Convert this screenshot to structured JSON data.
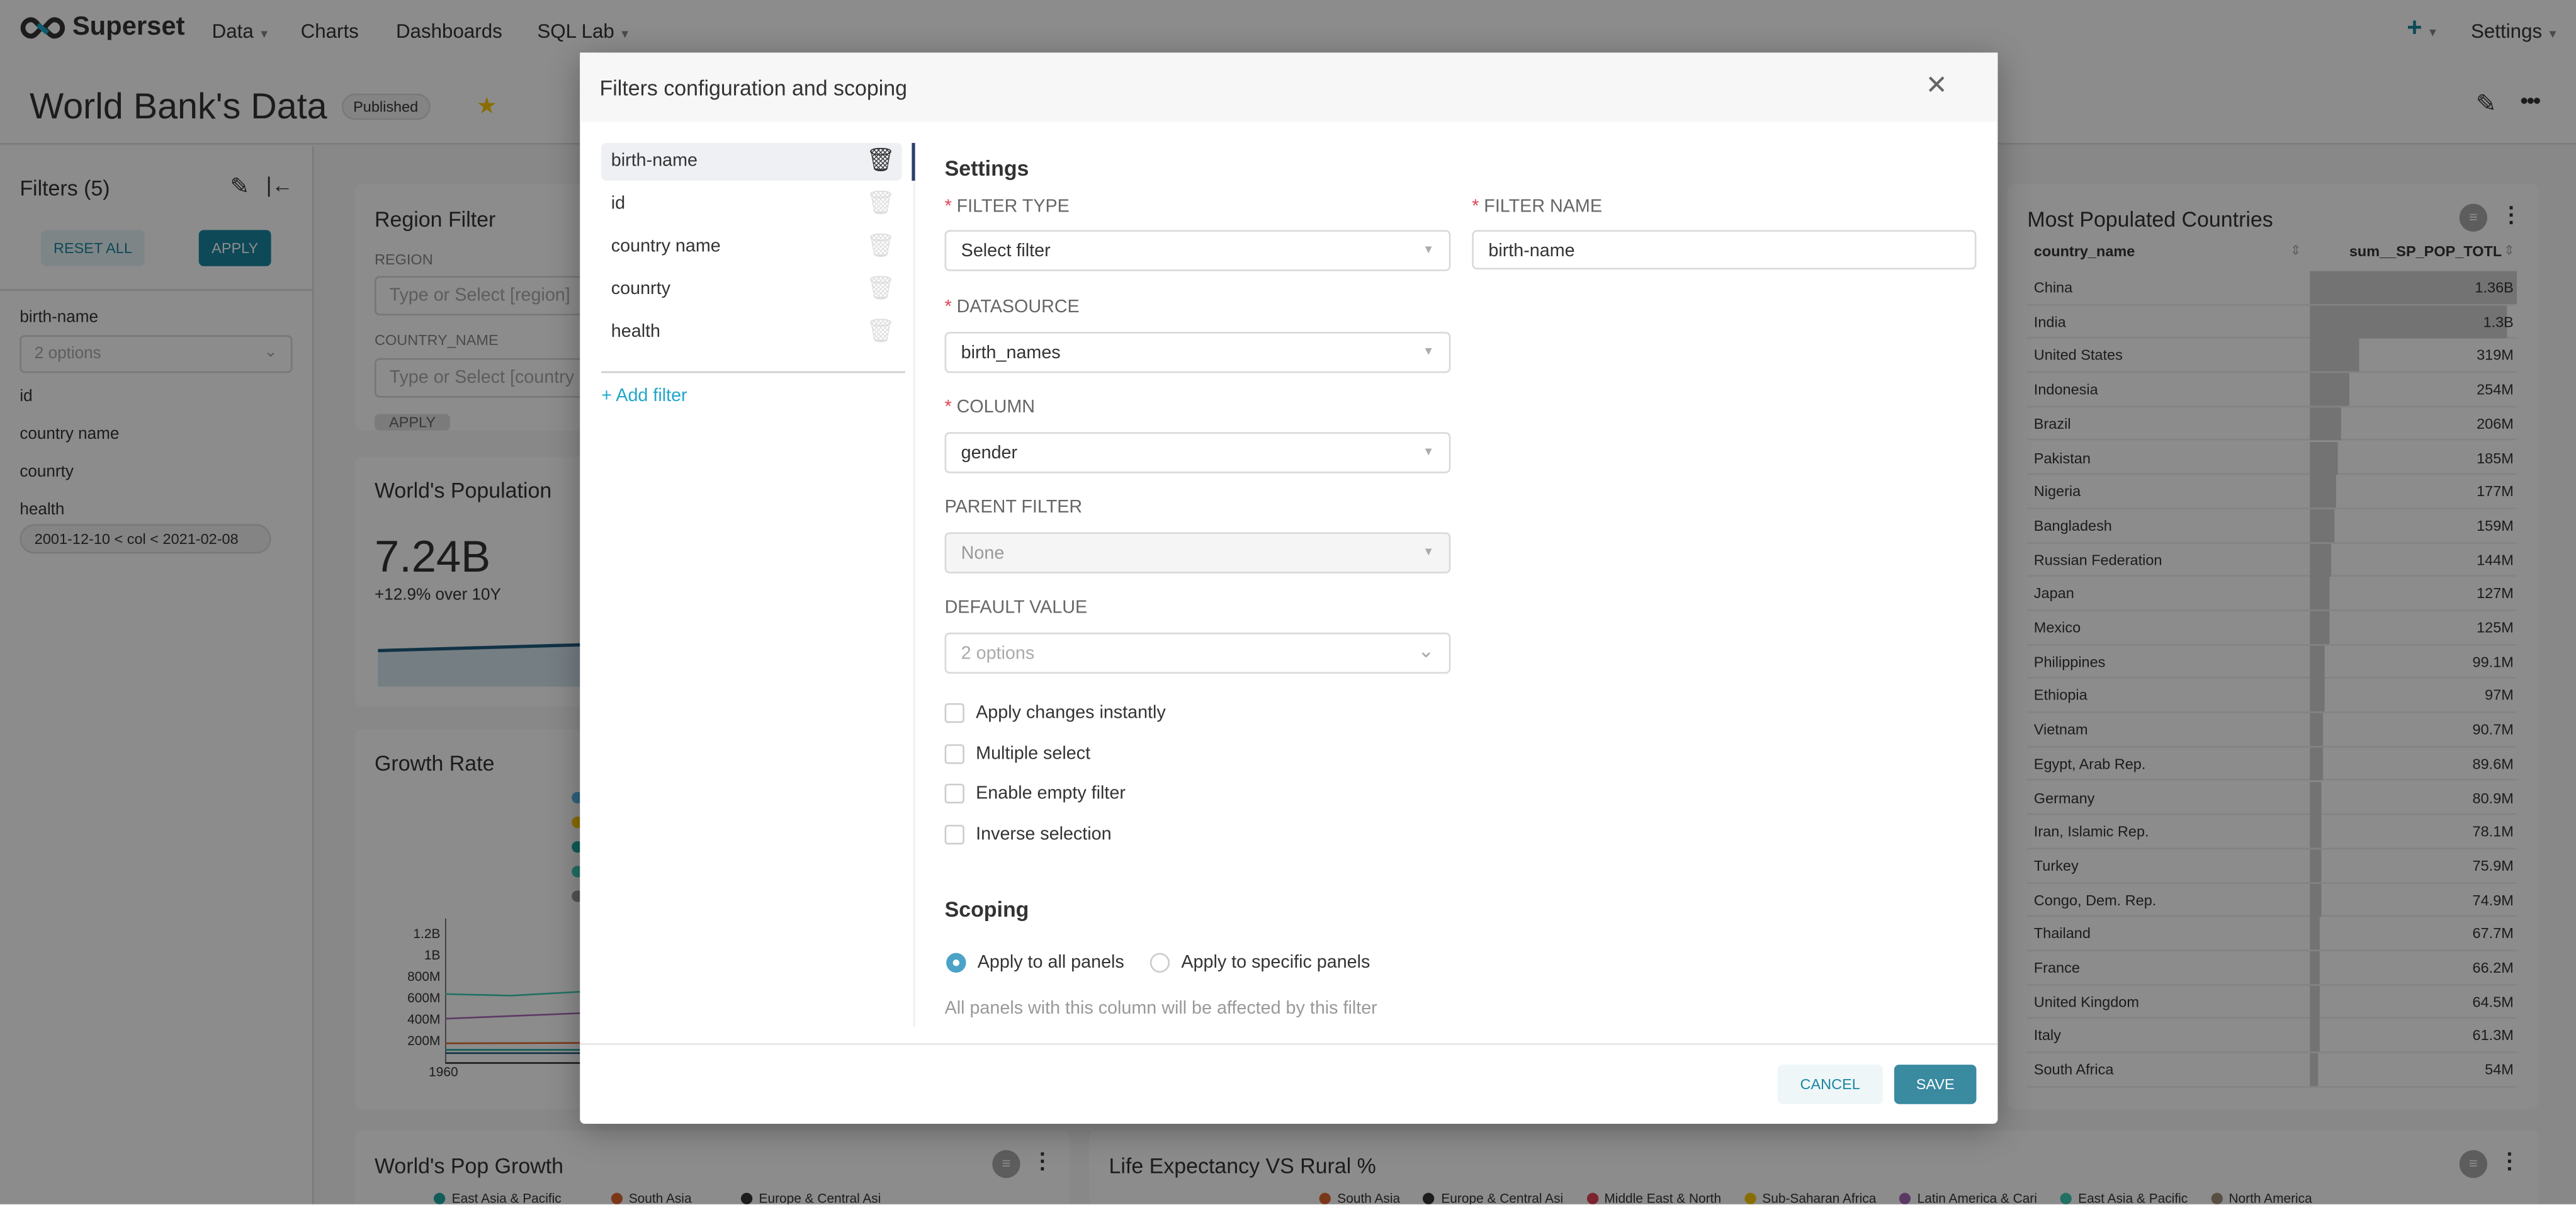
{
  "nav": {
    "brand": "Superset",
    "items": [
      "Data",
      "Charts",
      "Dashboards",
      "SQL Lab"
    ],
    "settings": "Settings"
  },
  "dashboard": {
    "title": "World Bank's Data",
    "status": "Published"
  },
  "sidebar": {
    "title": "Filters (5)",
    "reset": "RESET ALL",
    "apply": "APPLY",
    "filters": [
      {
        "name": "birth-name",
        "placeholder": "2 options"
      },
      {
        "name": "id"
      },
      {
        "name": "country name"
      },
      {
        "name": "counrty"
      },
      {
        "name": "health",
        "chip": "2001-12-10 < col < 2021-02-08"
      }
    ]
  },
  "region_filter": {
    "title": "Region Filter",
    "region_label": "REGION",
    "region_placeholder": "Type or Select [region]",
    "country_label": "COUNTRY_NAME",
    "country_placeholder": "Type or Select [country",
    "apply": "APPLY"
  },
  "worlds_population": {
    "title": "World's Population",
    "value": "7.24B",
    "subtitle": "+12.9% over 10Y"
  },
  "growth_rate": {
    "title": "Growth Rate",
    "yticks": [
      "1.2B",
      "1B",
      "800M",
      "600M",
      "400M",
      "200M"
    ],
    "xticks": [
      "1960"
    ]
  },
  "most_populated": {
    "title": "Most Populated Countries",
    "columns": [
      "country_name",
      "sum__SP_POP_TOTL"
    ],
    "rows": [
      [
        "China",
        "1.36B"
      ],
      [
        "India",
        "1.3B"
      ],
      [
        "United States",
        "319M"
      ],
      [
        "Indonesia",
        "254M"
      ],
      [
        "Brazil",
        "206M"
      ],
      [
        "Pakistan",
        "185M"
      ],
      [
        "Nigeria",
        "177M"
      ],
      [
        "Bangladesh",
        "159M"
      ],
      [
        "Russian Federation",
        "144M"
      ],
      [
        "Japan",
        "127M"
      ],
      [
        "Mexico",
        "125M"
      ],
      [
        "Philippines",
        "99.1M"
      ],
      [
        "Ethiopia",
        "97M"
      ],
      [
        "Vietnam",
        "90.7M"
      ],
      [
        "Egypt, Arab Rep.",
        "89.6M"
      ],
      [
        "Germany",
        "80.9M"
      ],
      [
        "Iran, Islamic Rep.",
        "78.1M"
      ],
      [
        "Turkey",
        "75.9M"
      ],
      [
        "Congo, Dem. Rep.",
        "74.9M"
      ],
      [
        "Thailand",
        "67.7M"
      ],
      [
        "France",
        "66.2M"
      ],
      [
        "United Kingdom",
        "64.5M"
      ],
      [
        "Italy",
        "61.3M"
      ],
      [
        "South Africa",
        "54M"
      ]
    ]
  },
  "pop_growth": {
    "title": "World's Pop Growth",
    "legend": [
      {
        "label": "East Asia & Pacific",
        "color": "#1fa8a0"
      },
      {
        "label": "South Asia",
        "color": "#e0662e"
      },
      {
        "label": "Europe & Central Asi",
        "color": "#333333"
      }
    ]
  },
  "life_expectancy": {
    "title": "Life Expectancy VS Rural %",
    "legend": [
      {
        "label": "South Asia",
        "color": "#e0662e"
      },
      {
        "label": "Europe & Central Asi",
        "color": "#333333"
      },
      {
        "label": "Middle East & North",
        "color": "#e04355"
      },
      {
        "label": "Sub-Saharan Africa",
        "color": "#fcc700"
      },
      {
        "label": "Latin America & Cari",
        "color": "#a868b7"
      },
      {
        "label": "East Asia & Pacific",
        "color": "#3cccb4"
      },
      {
        "label": "North America",
        "color": "#a38f79"
      }
    ]
  },
  "modal": {
    "title": "Filters configuration and scoping",
    "filters": [
      "birth-name",
      "id",
      "country name",
      "counrty",
      "health"
    ],
    "add_filter": "Add filter",
    "settings_title": "Settings",
    "filter_type_label": "FILTER TYPE",
    "filter_type_value": "Select filter",
    "filter_name_label": "FILTER NAME",
    "filter_name_value": "birth-name",
    "datasource_label": "DATASOURCE",
    "datasource_value": "birth_names",
    "column_label": "COLUMN",
    "column_value": "gender",
    "parent_label": "PARENT FILTER",
    "parent_value": "None",
    "default_label": "DEFAULT VALUE",
    "default_placeholder": "2 options",
    "checkboxes": [
      "Apply changes instantly",
      "Multiple select",
      "Enable empty filter",
      "Inverse selection"
    ],
    "scoping_title": "Scoping",
    "radio_all": "Apply to all panels",
    "radio_specific": "Apply to specific panels",
    "scoping_help": "All panels with this column will be affected by this filter",
    "cancel": "CANCEL",
    "save": "SAVE"
  },
  "colors": {
    "primary": "#20a7c9",
    "button_dark": "#1a85a0",
    "save": "#3a8aa0"
  }
}
